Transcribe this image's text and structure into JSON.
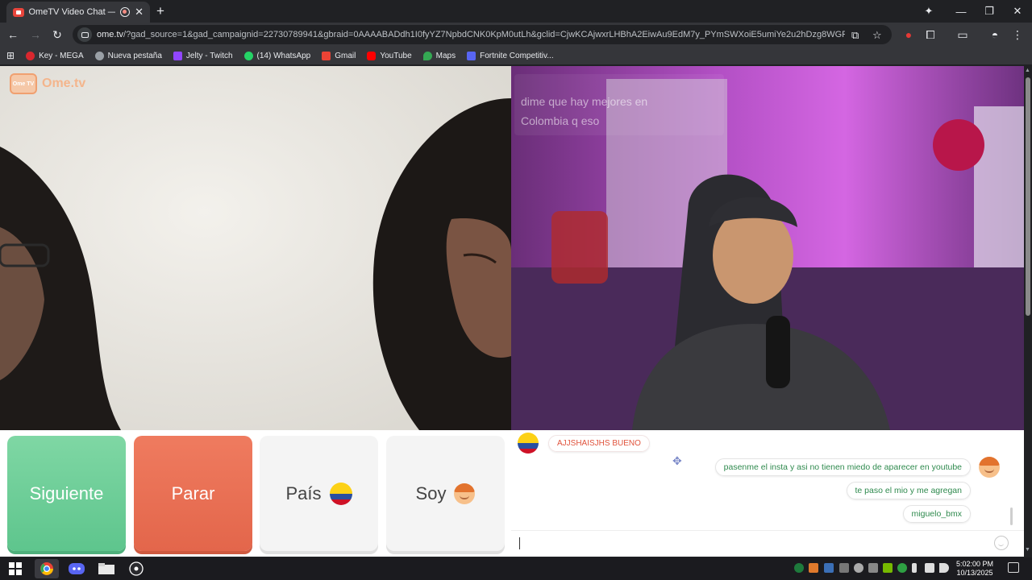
{
  "browser": {
    "tab_title": "OmeTV Video Chat — Ome",
    "tab_close": "✕",
    "new_tab": "+",
    "url_host": "ome.tv",
    "url_rest": "/?gad_source=1&gad_campaignid=22730789941&gbraid=0AAAABADdh1I0fyYZ7NpbdCNK0KpM0utLh&gclid=CjwKCAjwxrLHBhA2EiwAu9EdM7y_PYmSWXoiE5umiYe2u2hDzg8WGPHHa4P...",
    "window_controls": [
      "—",
      "❐",
      "✕"
    ]
  },
  "bookmarks": [
    {
      "label": "Key - MEGA",
      "color": "#d9272e"
    },
    {
      "label": "Nueva pestaña",
      "color": "#9aa0a6"
    },
    {
      "label": "Jelty - Twitch",
      "color": "#9146ff"
    },
    {
      "label": "(14) WhatsApp",
      "color": "#25d366"
    },
    {
      "label": "Gmail",
      "color": "#ea4335"
    },
    {
      "label": "YouTube",
      "color": "#ff0000"
    },
    {
      "label": "Maps",
      "color": "#34a853"
    },
    {
      "label": "Fortnite Competitiv...",
      "color": "#5865f2"
    }
  ],
  "logo": {
    "badge": "Ome TV",
    "text": "Ome.tv"
  },
  "stranger_overlay": [
    "dime que hay mejores en",
    "Colombia q eso"
  ],
  "controls": {
    "next_label": "Siguiente",
    "stop_label": "Parar",
    "country_label": "País",
    "gender_label": "Soy"
  },
  "chat": {
    "incoming": [
      {
        "text": "AJJSHAISJHS BUENO"
      }
    ],
    "outgoing": [
      {
        "text": "pasenme el insta y asi no tienen miedo de aparecer en youtube"
      },
      {
        "text": "te paso el mio y me agregan"
      },
      {
        "text": "miguelo_bmx"
      }
    ],
    "input_value": ""
  },
  "taskbar": {
    "time": "5:02:00 PM",
    "date": "10/13/2025"
  },
  "colors": {
    "next": "#6ccc97",
    "stop": "#e8704f",
    "incoming_text": "#e0533c",
    "outgoing_text": "#2f8a4e"
  }
}
